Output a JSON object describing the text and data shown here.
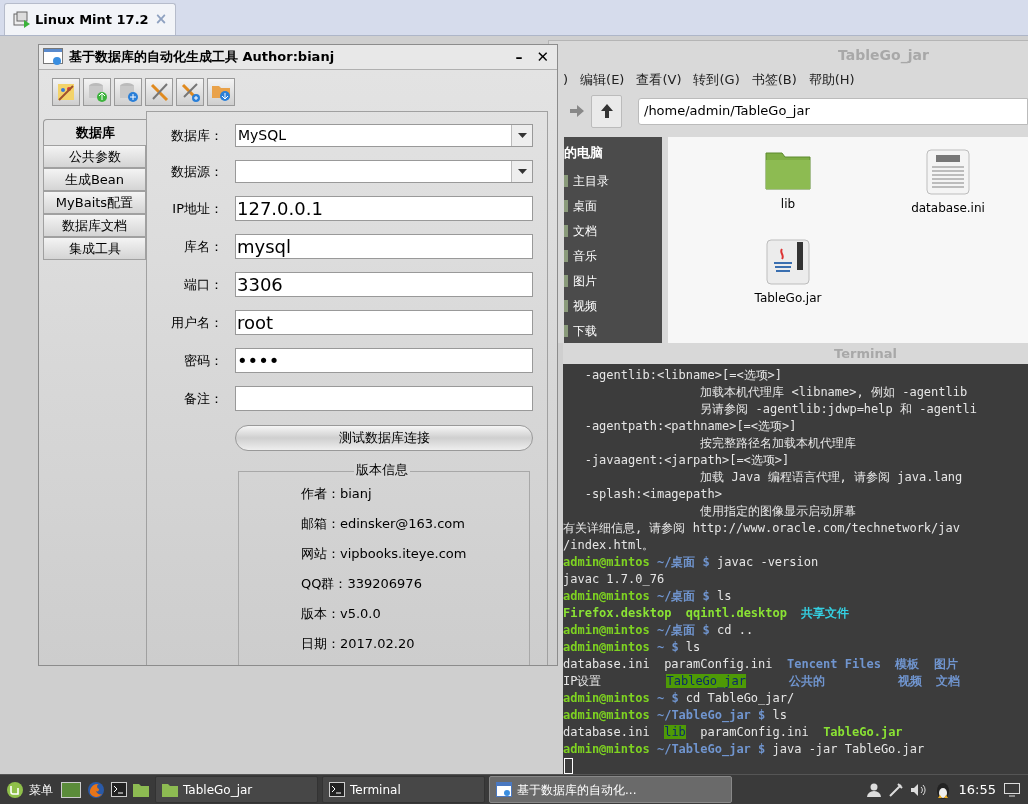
{
  "vm_tab": {
    "title": "Linux Mint 17.2",
    "close": "×"
  },
  "file_manager": {
    "title": "TableGo_jar",
    "menu": [
      ")",
      "编辑(E)",
      "查看(V)",
      "转到(G)",
      "书签(B)",
      "帮助(H)"
    ],
    "path": "/home/admin/TableGo_jar",
    "sidebar_heading": "的电脑",
    "sidebar": [
      "主目录",
      "桌面",
      "文档",
      "音乐",
      "图片",
      "视频",
      "下载"
    ],
    "files": [
      {
        "name": "lib",
        "kind": "folder"
      },
      {
        "name": "database.ini",
        "kind": "text"
      },
      {
        "name": "TableGo.jar",
        "kind": "jar"
      }
    ]
  },
  "terminal": {
    "title": "Terminal",
    "lines": [
      [
        {
          "kind": "text",
          "text": "   -agentlib:<libname>[=<选项>]"
        }
      ],
      [
        {
          "kind": "text",
          "text": "                   加载本机代理库 <libname>, 例如 -agentlib"
        }
      ],
      [
        {
          "kind": "text",
          "text": "                   另请参阅 -agentlib:jdwp=help 和 -agentli"
        }
      ],
      [
        {
          "kind": "text",
          "text": "   -agentpath:<pathname>[=<选项>]"
        }
      ],
      [
        {
          "kind": "text",
          "text": "                   按完整路径名加载本机代理库"
        }
      ],
      [
        {
          "kind": "text",
          "text": "   -javaagent:<jarpath>[=<选项>]"
        }
      ],
      [
        {
          "kind": "text",
          "text": "                   加载 Java 编程语言代理, 请参阅 java.lang"
        }
      ],
      [
        {
          "kind": "text",
          "text": "   -splash:<imagepath>"
        }
      ],
      [
        {
          "kind": "text",
          "text": "                   使用指定的图像显示启动屏幕"
        }
      ],
      [
        {
          "kind": "text",
          "text": "有关详细信息, 请参阅 http://www.oracle.com/technetwork/jav"
        }
      ],
      [
        {
          "kind": "text",
          "text": "/index.html。"
        }
      ],
      [
        {
          "kind": "user",
          "text": "admin@mintos"
        },
        {
          "kind": "path",
          "text": " ~/桌面 $"
        },
        {
          "kind": "text",
          "text": " javac -version"
        }
      ],
      [
        {
          "kind": "text",
          "text": "javac 1.7.0_76"
        }
      ],
      [
        {
          "kind": "user",
          "text": "admin@mintos"
        },
        {
          "kind": "path",
          "text": " ~/桌面 $"
        },
        {
          "kind": "text",
          "text": " ls"
        }
      ],
      [
        {
          "kind": "exec",
          "text": "Firefox.desktop  "
        },
        {
          "kind": "exec",
          "text": "qqintl.desktop  "
        },
        {
          "kind": "shared",
          "text": "共享文件"
        }
      ],
      [
        {
          "kind": "user",
          "text": "admin@mintos"
        },
        {
          "kind": "path",
          "text": " ~/桌面 $"
        },
        {
          "kind": "text",
          "text": " cd .."
        }
      ],
      [
        {
          "kind": "user",
          "text": "admin@mintos"
        },
        {
          "kind": "path",
          "text": " ~ $"
        },
        {
          "kind": "text",
          "text": " ls"
        }
      ],
      [
        {
          "kind": "text",
          "text": "database.ini  paramConfig.ini  "
        },
        {
          "kind": "dir",
          "text": "Tencent Files  "
        },
        {
          "kind": "dir",
          "text": "模板  "
        },
        {
          "kind": "dir",
          "text": "图片"
        }
      ],
      [
        {
          "kind": "text",
          "text": "IP设置         "
        },
        {
          "kind": "sticky",
          "text": "TableGo_jar"
        },
        {
          "kind": "dir",
          "text": "      公共的          "
        },
        {
          "kind": "dir",
          "text": "视频  "
        },
        {
          "kind": "dir",
          "text": "文档"
        }
      ],
      [
        {
          "kind": "user",
          "text": "admin@mintos"
        },
        {
          "kind": "path",
          "text": " ~ $"
        },
        {
          "kind": "text",
          "text": " cd TableGo_jar/"
        }
      ],
      [
        {
          "kind": "user",
          "text": "admin@mintos"
        },
        {
          "kind": "path",
          "text": " ~/TableGo_jar $"
        },
        {
          "kind": "text",
          "text": " ls"
        }
      ],
      [
        {
          "kind": "text",
          "text": "database.ini  "
        },
        {
          "kind": "sticky",
          "text": "lib"
        },
        {
          "kind": "text",
          "text": "  paramConfig.ini  "
        },
        {
          "kind": "exec",
          "text": "TableGo.jar"
        }
      ],
      [
        {
          "kind": "user",
          "text": "admin@mintos"
        },
        {
          "kind": "path",
          "text": " ~/TableGo_jar $"
        },
        {
          "kind": "text",
          "text": " java -jar TableGo.jar"
        }
      ]
    ]
  },
  "dialog": {
    "title": "基于数据库的自动化生成工具 Author:bianj",
    "minimize": "–",
    "close": "✕",
    "tabs": [
      {
        "label": "数据库",
        "selected": true
      },
      {
        "label": "公共参数",
        "selected": false
      },
      {
        "label": "生成Bean",
        "selected": false
      },
      {
        "label": "MyBaits配置",
        "selected": false
      },
      {
        "label": "数据库文档",
        "selected": false
      },
      {
        "label": "集成工具",
        "selected": false
      }
    ],
    "form": [
      {
        "label": "数据库：",
        "kind": "select",
        "value": "MySQL"
      },
      {
        "label": "数据源：",
        "kind": "select"
      },
      {
        "label": "IP地址：",
        "kind": "text",
        "value": "127.0.0.1"
      },
      {
        "label": "库名：",
        "kind": "text",
        "value": "mysql"
      },
      {
        "label": "端口：",
        "kind": "text",
        "value": "3306"
      },
      {
        "label": "用户名：",
        "kind": "text",
        "value": "root"
      },
      {
        "label": "密码：",
        "kind": "text",
        "value": "••••"
      },
      {
        "label": "备注：",
        "kind": "text"
      }
    ],
    "test_button": "测试数据库连接",
    "version_info": {
      "title": "版本信息",
      "lines": [
        "作者：bianj",
        "邮箱：edinsker@163.com",
        "网站：vipbooks.iteye.com",
        "QQ群：339206976",
        "版本：v5.0.0",
        "日期：2017.02.20"
      ]
    }
  },
  "taskbar": {
    "menu": "菜单",
    "tasks": [
      {
        "label": "TableGo_jar",
        "kind": "folder",
        "selected": false
      },
      {
        "label": "Terminal",
        "kind": "terminal",
        "selected": false
      },
      {
        "label": "基于数据库的自动化...",
        "kind": "app",
        "selected": true
      }
    ],
    "clock": "16:55"
  }
}
